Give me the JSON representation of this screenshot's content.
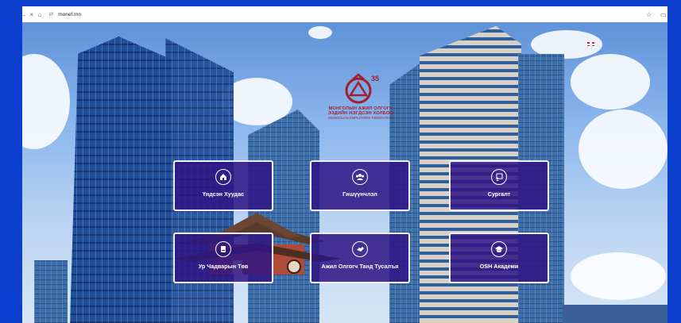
{
  "browser": {
    "url": "monef.mn",
    "nav_icons": [
      "back-icon",
      "forward-icon",
      "close-icon",
      "home-icon"
    ],
    "site_info_icon": "tune-icon",
    "right_icons": [
      "star-icon",
      "extensions-icon"
    ]
  },
  "logo": {
    "anniversary": "35",
    "line1": "МОНГОЛЫН АЖИЛ ОЛГОГЧ",
    "line2": "ЭЗДИЙН НЭГДСЭН ХОЛБОО",
    "line3": "MONGOLIAN EMPLOYERS' FEDERATION",
    "color": "#a51d2b"
  },
  "language_flag": "uk-flag-icon",
  "menu_cards": [
    {
      "label": "Үндсэн Хуудас",
      "icon": "home-icon"
    },
    {
      "label": "Гишүүнчлэл",
      "icon": "members-icon"
    },
    {
      "label": "Сургалт",
      "icon": "training-icon"
    },
    {
      "label": "Ур Чадварын Төв",
      "icon": "book-icon"
    },
    {
      "label": "Ажил Олгогч Танд Тусалъя",
      "icon": "handshake-icon"
    },
    {
      "label": "OSH Академи",
      "icon": "graduation-cap-icon"
    }
  ],
  "colors": {
    "card_background": "#2e1584",
    "card_border": "#f1f0f8",
    "outer_frame": "#0d3fcf"
  }
}
